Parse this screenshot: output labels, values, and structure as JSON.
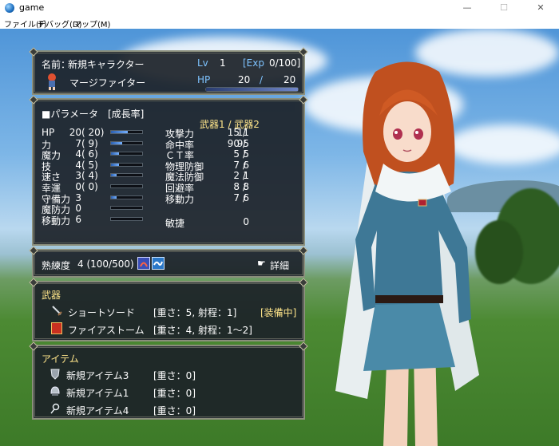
{
  "window": {
    "title": "game",
    "min": "—",
    "max": "☐",
    "close": "✕"
  },
  "menu": [
    "ファイル(F)",
    "デバッグ(D)",
    "マップ(M)"
  ],
  "status": {
    "name_label": "名前：",
    "name": "新規キャラクター",
    "class": "マージファイター",
    "lv_label": "Lv",
    "lv": "1",
    "exp_label": "[Exp",
    "exp": "0/100]",
    "hp_label": "HP",
    "hp": "20",
    "hp_sep": "/",
    "hp_max": "20",
    "hp_fraction": 1.0
  },
  "params": {
    "header": "■パラメータ",
    "growth_header": "[成長率]",
    "weapon_header": "武器1 / 武器2",
    "stats": [
      {
        "label": "HP",
        "value": "20",
        "growth": "( 20)",
        "fill": 0.55
      },
      {
        "label": "力",
        "value": "7",
        "growth": "(  9)",
        "fill": 0.35
      },
      {
        "label": "魔力",
        "value": "4",
        "growth": "(  6)",
        "fill": 0.25
      },
      {
        "label": "技",
        "value": "4",
        "growth": "(  5)",
        "fill": 0.25
      },
      {
        "label": "速さ",
        "value": "3",
        "growth": "(  4)",
        "fill": 0.18
      },
      {
        "label": "幸運",
        "value": "0",
        "growth": "(  0)",
        "fill": 0.0
      },
      {
        "label": "守備力",
        "value": "3",
        "growth": "",
        "fill": 0.18
      },
      {
        "label": "魔防力",
        "value": "0",
        "growth": "",
        "fill": 0.0
      },
      {
        "label": "移動力",
        "value": "6",
        "growth": "",
        "fill": 0.0
      }
    ],
    "combat": [
      {
        "label": "攻撃力",
        "v1": "15",
        "sep": "/",
        "v2": "11"
      },
      {
        "label": "命中率",
        "v1": "90",
        "sep": "/",
        "v2": "95"
      },
      {
        "label": "ＣＴ率",
        "v1": "5",
        "sep": "/",
        "v2": "5"
      },
      {
        "label": "物理防御",
        "v1": "7",
        "sep": "/",
        "v2": "6"
      },
      {
        "label": "魔法防御",
        "v1": "2",
        "sep": "/",
        "v2": "1"
      },
      {
        "label": "回避率",
        "v1": "8",
        "sep": "/",
        "v2": "8"
      },
      {
        "label": "移動力",
        "v1": "7",
        "sep": "/",
        "v2": "6"
      },
      {
        "label": "敏捷",
        "v1": "",
        "sep": "",
        "v2": "0"
      }
    ]
  },
  "proficiency": {
    "label": "熟練度",
    "value": "4 (100/500)",
    "detail": "詳細"
  },
  "weapons": {
    "header": "武器",
    "items": [
      {
        "icon": "sword-icon",
        "name": "ショートソード",
        "info": "[重さ：5, 射程：1]",
        "status": "[装備中]"
      },
      {
        "icon": "spellbook-icon",
        "name": "ファイアストーム",
        "info": "[重さ：4, 射程：1～2]",
        "status": ""
      }
    ]
  },
  "items": {
    "header": "アイテム",
    "entries": [
      {
        "icon": "shield-icon",
        "name": "新規アイテム3",
        "info": "[重さ：0]"
      },
      {
        "icon": "helmet-icon",
        "name": "新規アイテム1",
        "info": "[重さ：0]"
      },
      {
        "icon": "ring-icon",
        "name": "新規アイテム4",
        "info": "[重さ：0]"
      }
    ]
  },
  "colors": {
    "accent_blue": "#7ec3ff",
    "equip_yellow": "#ffe58a",
    "panel_bg": "#1c2228"
  }
}
